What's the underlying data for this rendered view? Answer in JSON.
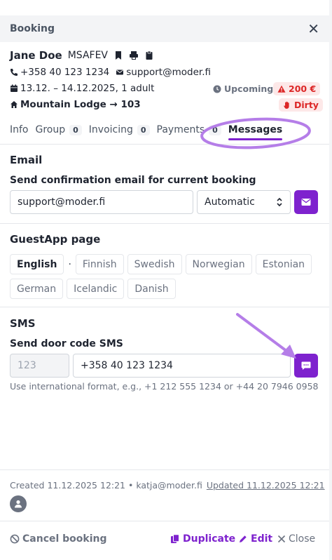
{
  "header": {
    "title": "Booking",
    "close_glyph": "✕"
  },
  "guest": {
    "name": "Jane Doe",
    "code": "MSAFEV",
    "icons": [
      "bookmark-icon",
      "printer-icon",
      "clipboard-icon"
    ]
  },
  "contact": {
    "phone": "+358 40 123 1234",
    "email": "support@moder.fi"
  },
  "stay": {
    "dates": "13.12. – 14.12.2025, 1 adult",
    "room": "Mountain Lodge → 103"
  },
  "badges": {
    "status": "Upcoming",
    "amount": "200 €",
    "cleaning": "Dirty"
  },
  "tabs": [
    {
      "label": "Info"
    },
    {
      "label": "Group",
      "count": "0"
    },
    {
      "label": "Invoicing",
      "count": "0"
    },
    {
      "label": "Payments",
      "count": "0"
    },
    {
      "label": "Messages"
    }
  ],
  "email": {
    "section_title": "Email",
    "subtitle": "Send confirmation email for current booking",
    "address": "support@moder.fi",
    "mode": "Automatic"
  },
  "guestapp": {
    "section_title": "GuestApp page",
    "languages": [
      "English",
      "Finnish",
      "Swedish",
      "Norwegian",
      "Estonian",
      "German",
      "Icelandic",
      "Danish"
    ],
    "selected": "English",
    "separator": "·"
  },
  "sms": {
    "section_title": "SMS",
    "subtitle": "Send door code SMS",
    "code_placeholder": "123",
    "phone": "+358 40 123 1234",
    "hint": "Use international format, e.g., +1 212 555 1234 or +44 20 7946 0958"
  },
  "meta": {
    "created": "Created 11.12.2025 12:21 • katja@moder.fi",
    "updated": "Updated 11.12.2025 12:21"
  },
  "footer": {
    "cancel": "Cancel booking",
    "duplicate": "Duplicate",
    "edit": "Edit",
    "close": "Close"
  },
  "colors": {
    "accent": "#7e22ce",
    "danger": "#dc2626",
    "annotation": "#b57ee8"
  }
}
